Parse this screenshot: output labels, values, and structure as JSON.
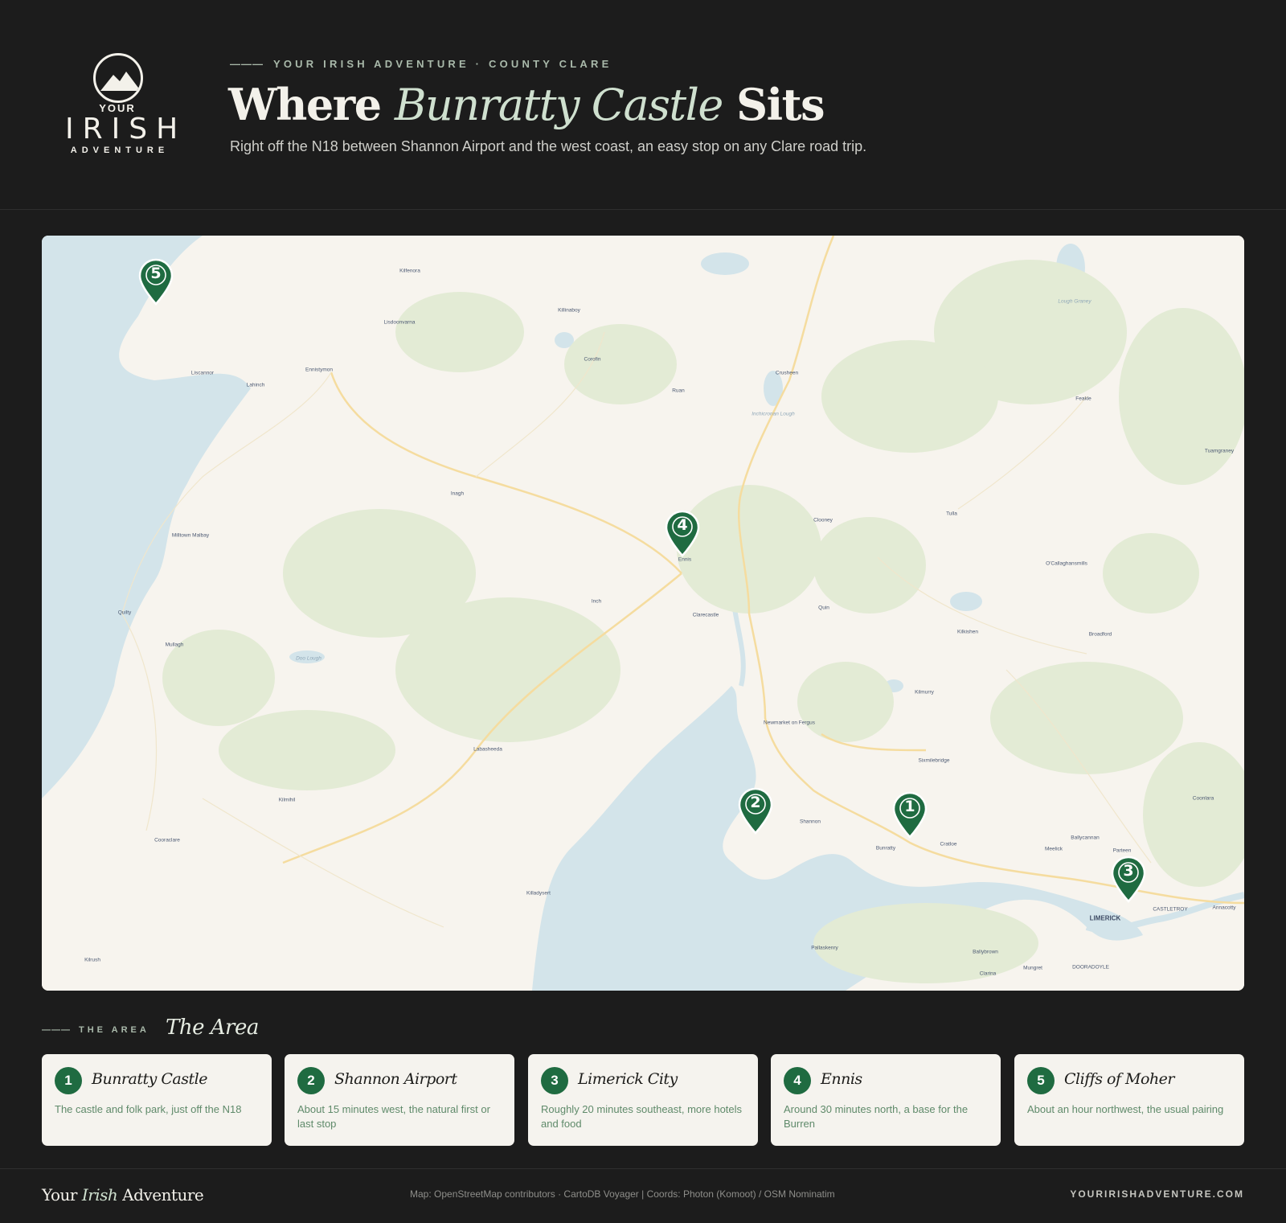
{
  "brand": {
    "logo_top": "YOUR",
    "logo_main": "IRISH",
    "logo_bottom": "ADVENTURE"
  },
  "header": {
    "kicker_dash": "———",
    "kicker": "YOUR IRISH ADVENTURE · COUNTY CLARE",
    "title_pre": "Where ",
    "title_em": "Bunratty Castle",
    "title_post": " Sits",
    "subtitle": "Right off the N18 between Shannon Airport and the west coast, an easy stop on any Clare road trip."
  },
  "map": {
    "places": [
      {
        "name": "Kilfenora"
      },
      {
        "name": "Killinaboy"
      },
      {
        "name": "Lisdoonvarna"
      },
      {
        "name": "Ennistymon"
      },
      {
        "name": "Lahinch"
      },
      {
        "name": "Liscannor"
      },
      {
        "name": "Corofin"
      },
      {
        "name": "Ruan"
      },
      {
        "name": "Crusheen"
      },
      {
        "name": "Inchicronan Lough"
      },
      {
        "name": "Feakle"
      },
      {
        "name": "Tuamgraney"
      },
      {
        "name": "Lough Graney"
      },
      {
        "name": "Inagh"
      },
      {
        "name": "Milltown Malbay"
      },
      {
        "name": "Ennis"
      },
      {
        "name": "Clooney"
      },
      {
        "name": "Tulla"
      },
      {
        "name": "O'Callaghansmills"
      },
      {
        "name": "Inch"
      },
      {
        "name": "Clarecastle"
      },
      {
        "name": "Quin"
      },
      {
        "name": "Quilty"
      },
      {
        "name": "Mullagh"
      },
      {
        "name": "Doo Lough"
      },
      {
        "name": "Kilkishen"
      },
      {
        "name": "Broadford"
      },
      {
        "name": "Kilmurry"
      },
      {
        "name": "Newmarket on Fergus"
      },
      {
        "name": "Sixmilebridge"
      },
      {
        "name": "Labasheeda"
      },
      {
        "name": "Kilmihil"
      },
      {
        "name": "Cooraclare"
      },
      {
        "name": "Shannon"
      },
      {
        "name": "Bunratty"
      },
      {
        "name": "Cratloe"
      },
      {
        "name": "Ballycannan"
      },
      {
        "name": "Meelick"
      },
      {
        "name": "Parteen"
      },
      {
        "name": "Coonlara"
      },
      {
        "name": "Killadysert"
      },
      {
        "name": "LIMERICK"
      },
      {
        "name": "CASTLETROY"
      },
      {
        "name": "Annacotty"
      },
      {
        "name": "Kilrush"
      },
      {
        "name": "Pallaskenry"
      },
      {
        "name": "Ballybrown"
      },
      {
        "name": "Mungret"
      },
      {
        "name": "Clarina"
      },
      {
        "name": "DOORADOYLE"
      }
    ],
    "markers": [
      {
        "num": "1",
        "name": "Bunratty Castle"
      },
      {
        "num": "2",
        "name": "Shannon Airport"
      },
      {
        "num": "3",
        "name": "Limerick City"
      },
      {
        "num": "4",
        "name": "Ennis"
      },
      {
        "num": "5",
        "name": "Cliffs of Moher"
      }
    ],
    "marker_color": "#1f6b41",
    "water_color": "#d3e4ea",
    "land_color": "#f7f4ee",
    "green_color": "#dfe8cf",
    "road_color": "#f6dca0"
  },
  "area": {
    "kicker_dash": "———",
    "kicker": "THE AREA",
    "title": "The Area",
    "cards": [
      {
        "num": "1",
        "title": "Bunratty Castle",
        "desc": "The castle and folk park, just off the N18"
      },
      {
        "num": "2",
        "title": "Shannon Airport",
        "desc": "About 15 minutes west, the natural first or last stop"
      },
      {
        "num": "3",
        "title": "Limerick City",
        "desc": "Roughly 20 minutes southeast, more hotels and food"
      },
      {
        "num": "4",
        "title": "Ennis",
        "desc": "Around 30 minutes north, a base for the Burren"
      },
      {
        "num": "5",
        "title": "Cliffs of Moher",
        "desc": "About an hour northwest, the usual pairing"
      }
    ]
  },
  "footer": {
    "brand_pre": "Your ",
    "brand_em": "Irish",
    "brand_post": " Adventure",
    "credit": "Map: OpenStreetMap contributors · CartoDB Voyager | Coords: Photon (Komoot) / OSM Nominatim",
    "url": "YOURIRISHADVENTURE.COM"
  }
}
